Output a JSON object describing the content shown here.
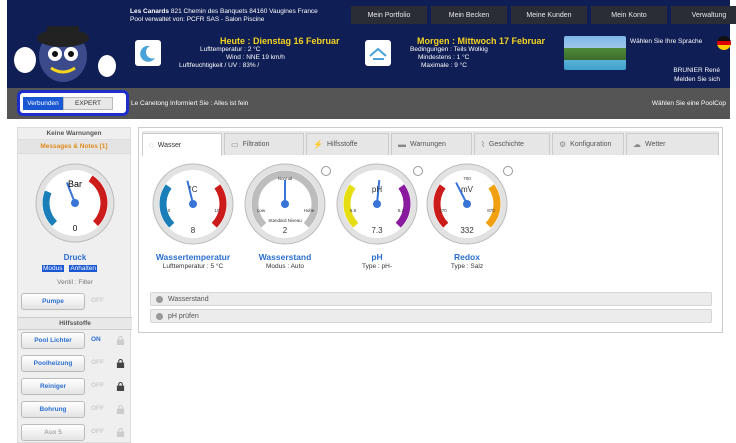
{
  "header": {
    "location_name": "Les Canards",
    "address": "821 Chemin des Banquets 84160 Vaugines France",
    "managed_by": "Pool verwaltet von: PCFR SAS - Salon Piscine",
    "nav": [
      "Mein Portfolio",
      "Mein Becken",
      "Meine Kunden",
      "Mein Konto",
      "Verwaltung"
    ],
    "today": {
      "title": "Heute : Dienstag 16 Februar",
      "lines": [
        "Lufttemperatur : 2 °C",
        "Wind : NNE 19 km/h",
        "Luftfeuchtigkeit / UV : 83% /"
      ]
    },
    "tomorrow": {
      "title": "Morgen : Mittwoch 17 Februar",
      "lines": [
        "Bedingungen : Teils Wolkig",
        "Mindestens : 1 °C",
        "Maximale : 9 °C"
      ]
    },
    "language": "Wählen Sie Ihre Sprache",
    "user": "BRUNIER René",
    "logout": "Melden Sie sich"
  },
  "statusbar": {
    "connected": "Verbunden",
    "expert": "EXPERT",
    "message": "Le Canetong Informiert Sie : Alles ist fein",
    "choose_pool": "Wählen Sie eine PoolCop"
  },
  "sidebar": {
    "warnings": "Keine Warnungen",
    "messages": "Messages & Notes [1]",
    "pump_gauge": {
      "label": "Bar",
      "value": "0",
      "level": 0.42
    },
    "title": "Druck",
    "modus": "Modus",
    "modus_value": "Anhalten",
    "ventil": "Ventil : Filter",
    "pump_btn": "Pumpe",
    "pump_state": "OFF",
    "section": "Hilfsstoffe",
    "items": [
      {
        "label": "Pool Lichter",
        "state": "ON",
        "locked": false,
        "active": true
      },
      {
        "label": "Poolheizung",
        "state": "OFF",
        "locked": true,
        "active": false
      },
      {
        "label": "Reiniger",
        "state": "OFF",
        "locked": true,
        "active": false
      },
      {
        "label": "Bohrung",
        "state": "OFF",
        "locked": false,
        "active": false
      },
      {
        "label": "Aux 5",
        "state": "OFF",
        "locked": false,
        "active": false
      }
    ]
  },
  "tabs": [
    "Wasser",
    "Filtration",
    "Hilfsstoffe",
    "Warnungen",
    "Geschichte",
    "Konfiguration",
    "Wetter"
  ],
  "gauges": [
    {
      "unit": "°C",
      "value": "8",
      "min": "0",
      "max": "10",
      "level": 0.45,
      "title": "Wassertemperatur",
      "sub": "Lufttemperatur : 5 °C",
      "colors": [
        "#1a7fb8",
        "#cc1b1b"
      ]
    },
    {
      "unit": "",
      "value": "2",
      "min": "Low",
      "max": "Hohe",
      "level": 0.5,
      "title": "Wasserstand",
      "sub": "Modus : Auto",
      "colors": [
        "#bdbdbd",
        "#bdbdbd"
      ],
      "top": "Normal",
      "bottom": "Standard Niveau"
    },
    {
      "unit": "pH",
      "value": "7.3",
      "min": "6.8",
      "max": "8.2",
      "level": 0.52,
      "title": "pH",
      "sub": "Type : pH-",
      "colors": [
        "#e6de12",
        "#8a1a9e"
      ]
    },
    {
      "unit": "mV",
      "value": "332",
      "min": "470",
      "max": "870",
      "level": 0.4,
      "title": "Redox",
      "sub": "Type : Salz",
      "colors": [
        "#cc1b1b",
        "#f0a010"
      ],
      "top": "700"
    }
  ],
  "panels": [
    "Wasserstand",
    "pH prüfen"
  ]
}
